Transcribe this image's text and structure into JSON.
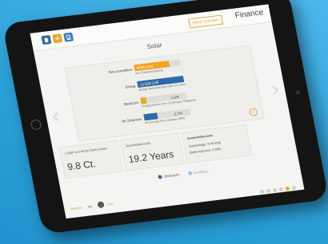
{
  "header": {
    "offer_button": "Offerte anfordern",
    "app_title": "Finance",
    "nav_buttons": [
      "home-icon",
      "sun-icon",
      "house-icon"
    ]
  },
  "page_title": "Solar",
  "rows": [
    {
      "label": "Ihre Investition",
      "value": "8'500 CHF",
      "sub": "inkl. Einmalvergütung",
      "fraction": 0.75,
      "color": "#f0a424",
      "value_dark": false
    },
    {
      "label": "Ertrag",
      "value": "12'226 CHF",
      "sub": "abzügl. Betriebskosten über 25 Jahre",
      "fraction": 1.0,
      "color": "#2f6aa8",
      "value_dark": false
    },
    {
      "label": "Bankzins",
      "value": "1.0%",
      "sub": "Vergleichszins einer 10-jährigen Obligation",
      "fraction": 0.12,
      "color": "#f0a424",
      "value_dark": true
    },
    {
      "label": "Ihr Solarzins",
      "value": "2.7%",
      "sub": "Verzinsung Ihres Kapitals (IRR)",
      "fraction": 0.3,
      "color": "#2f6aa8",
      "value_dark": true
    }
  ],
  "tiles": {
    "cost": {
      "title": "1 kWh von Ihrem Dach kostet",
      "value": "9.8 Ct."
    },
    "amort": {
      "title": "Amortisationszeit",
      "value": "19.2 Years"
    },
    "system": {
      "title": "Systemübersicht",
      "line1": "Solaranlage: 4.48 kWp",
      "line2": "Batteriegrösse: 0 kWh"
    }
  },
  "pager": {
    "active": "Übersicht",
    "inactive": "Geldfluss"
  },
  "footer": {
    "label": "Batterie",
    "on": "An",
    "off": "Aus"
  },
  "page_dots": {
    "count": 6,
    "active_index": 4
  }
}
